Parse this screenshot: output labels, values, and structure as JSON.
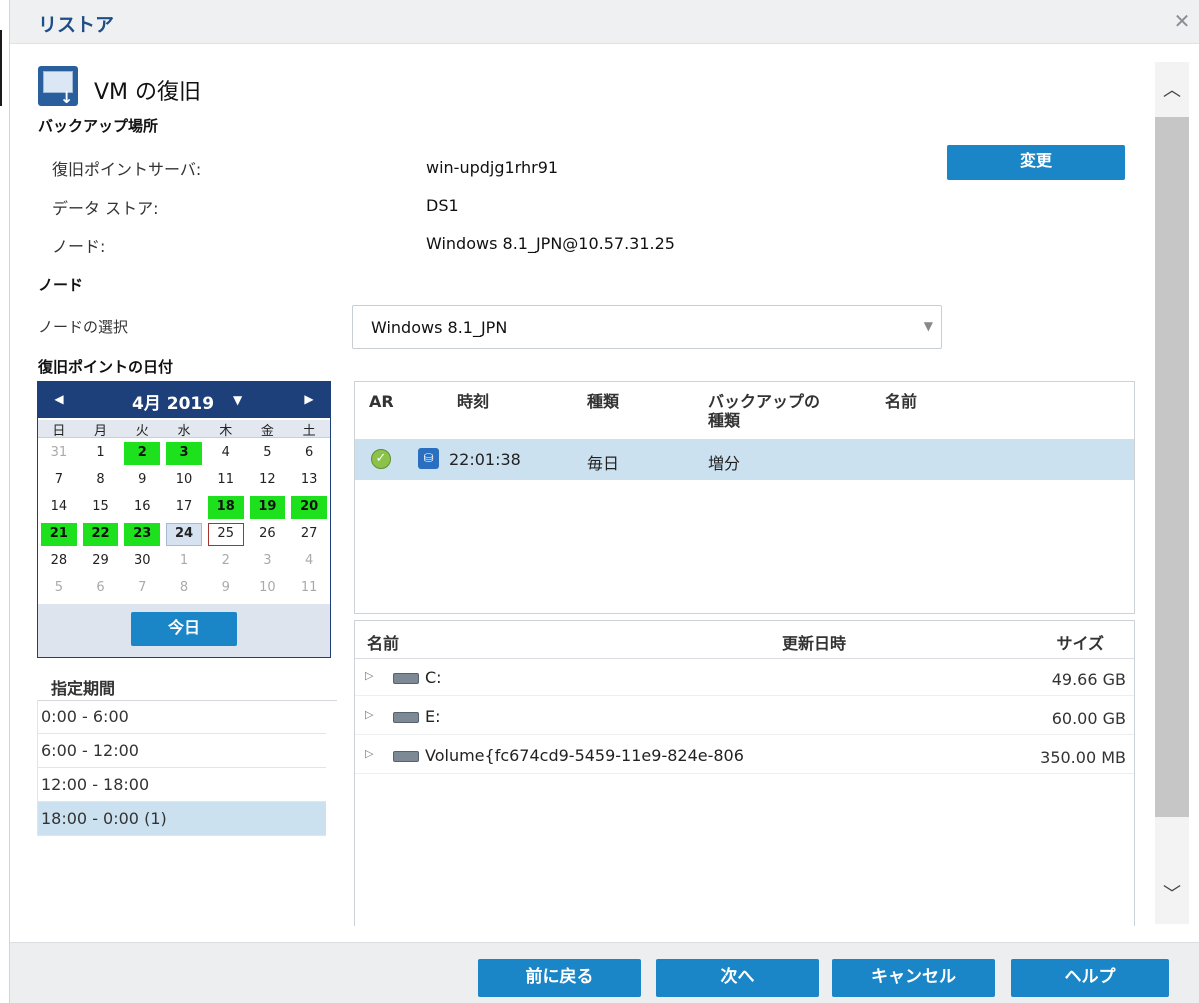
{
  "dialog": {
    "title": "リストア",
    "close_icon": "close-icon"
  },
  "header": {
    "title": "VM の復旧",
    "icon": "vm-recovery-icon"
  },
  "backup_location": {
    "section": "バックアップ場所",
    "rps_label": "復旧ポイントサーバ:",
    "rps_value": "win-updjg1rhr91",
    "datastore_label": "データ ストア:",
    "datastore_value": "DS1",
    "node_label": "ノード:",
    "node_value": "Windows 8.1_JPN@10.57.31.25",
    "change_button": "変更"
  },
  "node": {
    "section": "ノード",
    "select_label": "ノードの選択",
    "select_value": "Windows 8.1_JPN"
  },
  "recovery_date": {
    "section": "復旧ポイントの日付",
    "calendar": {
      "month": "4月 2019",
      "prev_icon": "triangle-left-icon",
      "next_icon": "triangle-right-icon",
      "weekdays": [
        "日",
        "月",
        "火",
        "水",
        "木",
        "金",
        "土"
      ],
      "today_button": "今日",
      "days": [
        {
          "d": "31",
          "s": "other"
        },
        {
          "d": "1",
          "s": ""
        },
        {
          "d": "2",
          "s": "rp"
        },
        {
          "d": "3",
          "s": "rp"
        },
        {
          "d": "4",
          "s": ""
        },
        {
          "d": "5",
          "s": ""
        },
        {
          "d": "6",
          "s": ""
        },
        {
          "d": "7",
          "s": ""
        },
        {
          "d": "8",
          "s": ""
        },
        {
          "d": "9",
          "s": ""
        },
        {
          "d": "10",
          "s": ""
        },
        {
          "d": "11",
          "s": ""
        },
        {
          "d": "12",
          "s": ""
        },
        {
          "d": "13",
          "s": ""
        },
        {
          "d": "14",
          "s": ""
        },
        {
          "d": "15",
          "s": ""
        },
        {
          "d": "16",
          "s": ""
        },
        {
          "d": "17",
          "s": ""
        },
        {
          "d": "18",
          "s": "rp"
        },
        {
          "d": "19",
          "s": "rp"
        },
        {
          "d": "20",
          "s": "rp"
        },
        {
          "d": "21",
          "s": "rp"
        },
        {
          "d": "22",
          "s": "rp"
        },
        {
          "d": "23",
          "s": "rp"
        },
        {
          "d": "24",
          "s": "sel"
        },
        {
          "d": "25",
          "s": "today"
        },
        {
          "d": "26",
          "s": ""
        },
        {
          "d": "27",
          "s": ""
        },
        {
          "d": "28",
          "s": ""
        },
        {
          "d": "29",
          "s": ""
        },
        {
          "d": "30",
          "s": ""
        },
        {
          "d": "1",
          "s": "other"
        },
        {
          "d": "2",
          "s": "other"
        },
        {
          "d": "3",
          "s": "other"
        },
        {
          "d": "4",
          "s": "other"
        },
        {
          "d": "5",
          "s": "other"
        },
        {
          "d": "6",
          "s": "other"
        },
        {
          "d": "7",
          "s": "other"
        },
        {
          "d": "8",
          "s": "other"
        },
        {
          "d": "9",
          "s": "other"
        },
        {
          "d": "10",
          "s": "other"
        },
        {
          "d": "11",
          "s": "other"
        }
      ]
    },
    "period": {
      "title": "指定期間",
      "ranges": [
        "0:00 - 6:00",
        "6:00 - 12:00",
        "12:00 - 18:00",
        "18:00 - 0:00 (1)"
      ],
      "active_index": 3
    }
  },
  "recovery_points": {
    "headers": {
      "ar": "AR",
      "time": "時刻",
      "type": "種類",
      "backup_type": "バックアップの\n種類",
      "name": "名前"
    },
    "rows": [
      {
        "ar_icon": "check-circle-icon",
        "type_icon": "encrypted-backup-icon",
        "time": "22:01:38",
        "type": "毎日",
        "backup_type": "増分",
        "name": ""
      }
    ]
  },
  "files": {
    "headers": {
      "name": "名前",
      "modified": "更新日時",
      "size": "サイズ"
    },
    "rows": [
      {
        "name": "C:",
        "size": "49.66 GB",
        "icon": "drive-icon"
      },
      {
        "name": "E:",
        "size": "60.00 GB",
        "icon": "drive-icon"
      },
      {
        "name": "Volume{fc674cd9-5459-11e9-824e-806",
        "size": "350.00 MB",
        "icon": "drive-icon"
      }
    ]
  },
  "footer": {
    "back": "前に戻る",
    "next": "次へ",
    "cancel": "キャンセル",
    "help": "ヘルプ"
  },
  "colors": {
    "accent": "#1a86c8",
    "title": "#1d4e86",
    "calendar_header": "#1d3f7a",
    "recovery_day": "#1ee11e",
    "selected_row": "#cce1f0"
  }
}
